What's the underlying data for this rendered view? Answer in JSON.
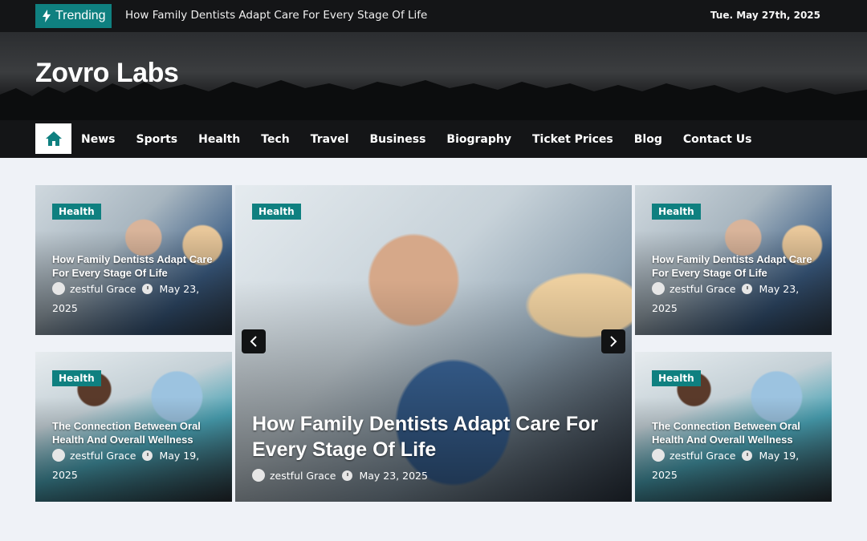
{
  "trending": {
    "label": "Trending",
    "headline": "How Family Dentists Adapt Care For Every Stage Of Life",
    "date": "Tue. May 27th, 2025"
  },
  "site": {
    "title": "Zovro Labs"
  },
  "nav": {
    "items": [
      "News",
      "Sports",
      "Health",
      "Tech",
      "Travel",
      "Business",
      "Biography",
      "Ticket Prices",
      "Blog",
      "Contact Us"
    ]
  },
  "cards": {
    "top_left": {
      "category": "Health",
      "title": "How Family Dentists Adapt Care For Every Stage Of Life",
      "author": "zestful Grace",
      "date": "May 23, 2025"
    },
    "bottom_left": {
      "category": "Health",
      "title": "The Connection Between Oral Health And Overall Wellness",
      "author": "zestful Grace",
      "date": "May 19, 2025"
    },
    "featured": {
      "category": "Health",
      "title": "How Family Dentists Adapt Care For Every Stage Of Life",
      "author": "zestful Grace",
      "date": "May 23, 2025"
    },
    "top_right": {
      "category": "Health",
      "title": "How Family Dentists Adapt Care For Every Stage Of Life",
      "author": "zestful Grace",
      "date": "May 23, 2025"
    },
    "bottom_right": {
      "category": "Health",
      "title": "The Connection Between Oral Health And Overall Wellness",
      "author": "zestful Grace",
      "date": "May 19, 2025"
    }
  },
  "colors": {
    "accent": "#0f8080",
    "dark": "#141517",
    "background": "#eff2f7"
  }
}
